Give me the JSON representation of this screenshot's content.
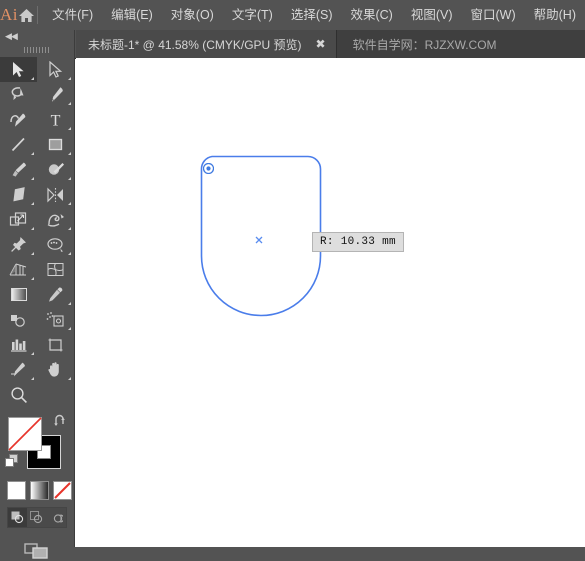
{
  "app": {
    "logo_text": "Ai",
    "home_icon": "home-icon"
  },
  "menu": {
    "items": [
      {
        "label": "文件(F)",
        "name": "menu-file"
      },
      {
        "label": "编辑(E)",
        "name": "menu-edit"
      },
      {
        "label": "对象(O)",
        "name": "menu-object"
      },
      {
        "label": "文字(T)",
        "name": "menu-type"
      },
      {
        "label": "选择(S)",
        "name": "menu-select"
      },
      {
        "label": "效果(C)",
        "name": "menu-effect"
      },
      {
        "label": "视图(V)",
        "name": "menu-view"
      },
      {
        "label": "窗口(W)",
        "name": "menu-window"
      },
      {
        "label": "帮助(H)",
        "name": "menu-help"
      }
    ]
  },
  "tabbar": {
    "document_title": "未标题-1* @ 41.58% (CMYK/GPU 预览)",
    "close_label": "✖",
    "watermark": "软件自学网：RJZXW.COM"
  },
  "toolbar": {
    "collapse_label": "◀◀",
    "tools": [
      {
        "name": "selection-tool",
        "icon": "arrow-solid",
        "active": true,
        "corner": true
      },
      {
        "name": "direct-selection-tool",
        "icon": "arrow-outline",
        "active": false,
        "corner": true
      },
      {
        "name": "lasso-tool",
        "icon": "lasso",
        "active": false,
        "corner": false
      },
      {
        "name": "pen-tool",
        "icon": "pen",
        "active": false,
        "corner": true
      },
      {
        "name": "curvature-tool",
        "icon": "curvature",
        "active": false,
        "corner": false
      },
      {
        "name": "type-tool",
        "icon": "type-T",
        "active": false,
        "corner": true
      },
      {
        "name": "line-segment-tool",
        "icon": "line",
        "active": false,
        "corner": true
      },
      {
        "name": "rectangle-tool",
        "icon": "rectangle",
        "active": false,
        "corner": true
      },
      {
        "name": "paintbrush-tool",
        "icon": "paintbrush",
        "active": false,
        "corner": true
      },
      {
        "name": "shaper-tool",
        "icon": "shaper",
        "active": false,
        "corner": true
      },
      {
        "name": "eraser-tool",
        "icon": "eraser",
        "active": false,
        "corner": true
      },
      {
        "name": "rotate-tool",
        "icon": "reflect",
        "active": false,
        "corner": true
      },
      {
        "name": "scale-tool",
        "icon": "scale",
        "active": false,
        "corner": true
      },
      {
        "name": "width-tool",
        "icon": "warp",
        "active": false,
        "corner": true
      },
      {
        "name": "free-transform-tool",
        "icon": "pushpin",
        "active": false,
        "corner": true
      },
      {
        "name": "shape-builder-tool",
        "icon": "shape-builder",
        "active": false,
        "corner": true
      },
      {
        "name": "perspective-grid-tool",
        "icon": "perspective-grid",
        "active": false,
        "corner": true
      },
      {
        "name": "mesh-tool",
        "icon": "mesh",
        "active": false,
        "corner": false
      },
      {
        "name": "gradient-tool",
        "icon": "gradient",
        "active": false,
        "corner": false
      },
      {
        "name": "eyedropper-tool",
        "icon": "eyedropper",
        "active": false,
        "corner": true
      },
      {
        "name": "blend-tool",
        "icon": "blend",
        "active": false,
        "corner": false
      },
      {
        "name": "symbol-sprayer-tool",
        "icon": "symbol-sprayer",
        "active": false,
        "corner": true
      },
      {
        "name": "column-graph-tool",
        "icon": "bar-chart",
        "active": false,
        "corner": true
      },
      {
        "name": "artboard-tool",
        "icon": "artboard",
        "active": false,
        "corner": false
      },
      {
        "name": "slice-tool",
        "icon": "slice",
        "active": false,
        "corner": true
      },
      {
        "name": "hand-tool",
        "icon": "hand",
        "active": false,
        "corner": true
      },
      {
        "name": "zoom-tool",
        "icon": "magnifier",
        "active": false,
        "corner": false
      }
    ],
    "fill_color": "#ffffff",
    "stroke_color": "#000000",
    "swap_icon": "swap-arrow-icon",
    "color_modes": [
      {
        "name": "color-swatch-button",
        "label": "色"
      },
      {
        "name": "gradient-swatch-button",
        "label": "渐变"
      },
      {
        "name": "none-swatch-button",
        "label": "无"
      }
    ],
    "draw_modes": [
      {
        "name": "draw-normal-button",
        "active": true
      },
      {
        "name": "draw-behind-button",
        "active": false
      },
      {
        "name": "draw-inside-button",
        "active": false
      }
    ],
    "screen_mode": {
      "name": "screen-mode-button"
    }
  },
  "canvas": {
    "shape": {
      "name": "rounded-rectangle-path",
      "stroke_color": "#4a7dea",
      "top_radius": 13,
      "bottom_radius": 60
    },
    "corner_widget": {
      "name": "live-corner-widget"
    },
    "center_mark": {
      "name": "shape-center-mark"
    },
    "radius_tooltip": {
      "text": "R: 10.33 mm",
      "value": "10.33",
      "unit": "mm"
    }
  }
}
